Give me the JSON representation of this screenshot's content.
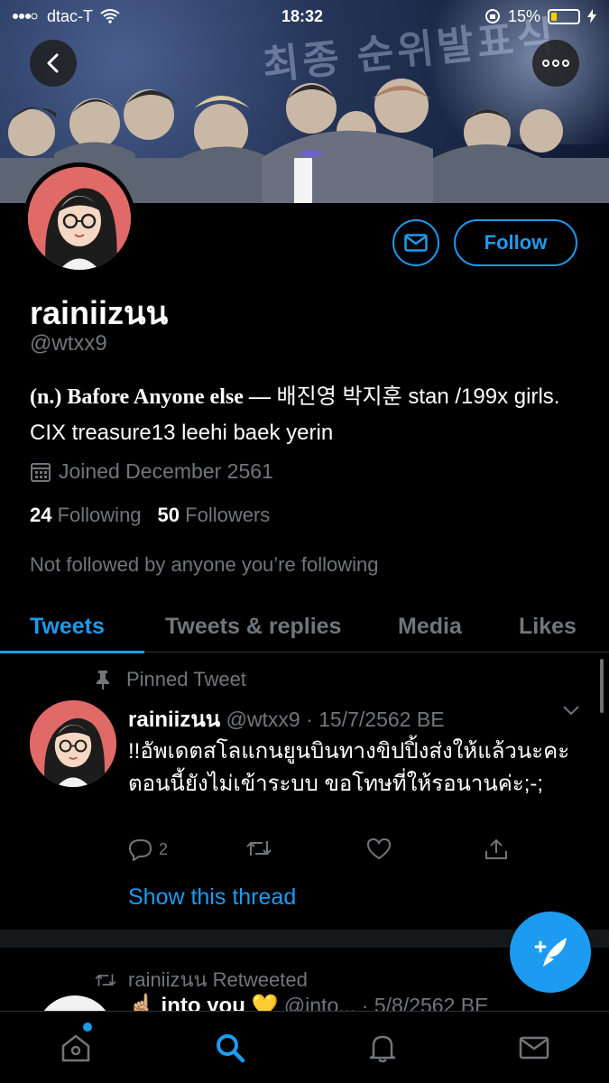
{
  "status_bar": {
    "carrier": "dtac-T",
    "time": "18:32",
    "battery": "15%"
  },
  "banner": {
    "overlay_text": "최종 순위발표식"
  },
  "profile": {
    "name": "rainiizนน",
    "handle": "@wtxx9",
    "bio_serif": "(n.) Bafore Anyone else —",
    "bio_rest": " 배진영 박지훈 stan /199x girls. CIX treasure13 leehi baek yerin",
    "joined": "Joined December 2561",
    "following_count": "24",
    "following_label": "Following",
    "followers_count": "50",
    "followers_label": "Followers",
    "not_followed": "Not followed by anyone you’re following"
  },
  "buttons": {
    "follow": "Follow"
  },
  "tabs": [
    {
      "label": "Tweets",
      "active": true
    },
    {
      "label": "Tweets & replies",
      "active": false
    },
    {
      "label": "Media",
      "active": false
    },
    {
      "label": "Likes",
      "active": false
    }
  ],
  "pinned_tweet": {
    "pinned_label": "Pinned Tweet",
    "author": "rainiizนน",
    "meta": "@wtxx9 · 15/7/2562 BE",
    "text": "!!อัพเดตสโลแกนยูนบินทางขิปปิ้งส่งให้แล้วนะคะตอนนี้ยังไม่เข้าระบบ ขอโทษที่ให้รอนานค่ะ;-;",
    "reply_count": "2",
    "show_thread": "Show this thread"
  },
  "retweet": {
    "retweeted_by": "rainiizนน Retweeted",
    "author": "☝🏼 into you 💛",
    "meta": "@into... · 5/8/2562 BE"
  },
  "colors": {
    "accent": "#1d9bf0",
    "background": "#000000",
    "muted": "#71767b"
  },
  "icons": [
    "back-arrow-icon",
    "more-dots-icon",
    "mail-icon",
    "calendar-icon",
    "pin-icon",
    "chevron-down-icon",
    "reply-icon",
    "retweet-icon",
    "like-icon",
    "share-icon",
    "compose-icon",
    "home-icon",
    "search-icon",
    "notifications-icon",
    "messages-icon"
  ]
}
